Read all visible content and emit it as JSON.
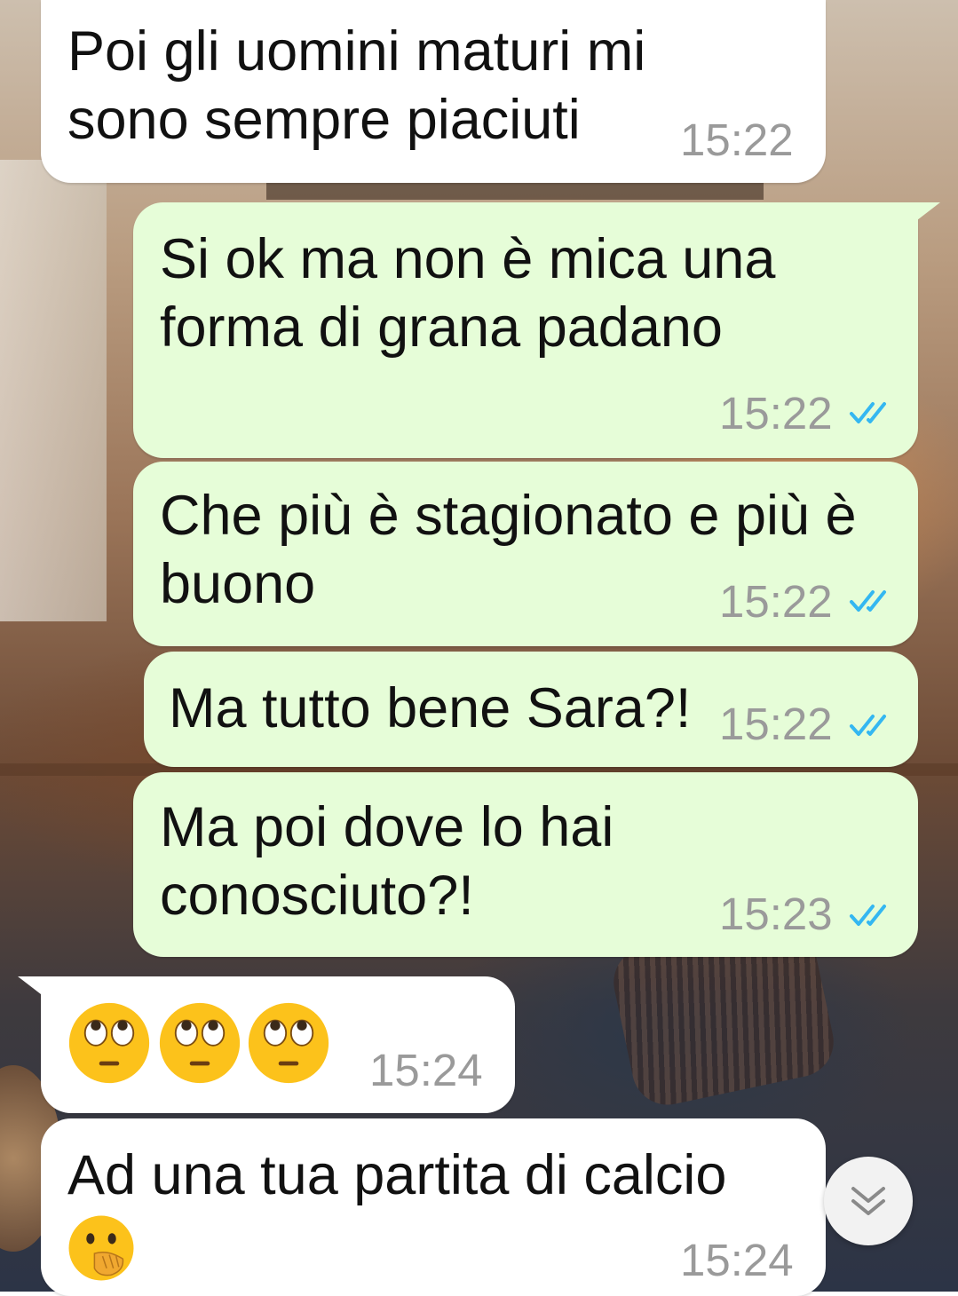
{
  "messages": [
    {
      "direction": "incoming",
      "text": "Poi gli uomini maturi mi\nsono sempre piaciuti",
      "time": "15:22"
    },
    {
      "direction": "outgoing",
      "text": "Si ok ma non è mica una\nforma di grana padano",
      "time": "15:22",
      "status": "read"
    },
    {
      "direction": "outgoing",
      "text": "Che più è stagionato e più è\nbuono",
      "time": "15:22",
      "status": "read"
    },
    {
      "direction": "outgoing",
      "text": "Ma tutto bene Sara?!",
      "time": "15:22",
      "status": "read"
    },
    {
      "direction": "outgoing",
      "text": "Ma poi dove lo hai\nconosciuto?!",
      "time": "15:23",
      "status": "read"
    },
    {
      "direction": "incoming",
      "emojis": [
        "face-with-rolling-eyes",
        "face-with-rolling-eyes",
        "face-with-rolling-eyes"
      ],
      "time": "15:24"
    },
    {
      "direction": "incoming",
      "text": "Ad una tua partita di calcio",
      "emoji": "face-with-hand-over-mouth",
      "time": "15:24"
    }
  ],
  "colors": {
    "incoming_bubble": "#ffffff",
    "outgoing_bubble": "#e6fdd8",
    "read_ticks": "#34b7f1",
    "timestamp": "#9a9a9a"
  },
  "scroll_button": {
    "icon": "double-chevron-down-icon"
  }
}
